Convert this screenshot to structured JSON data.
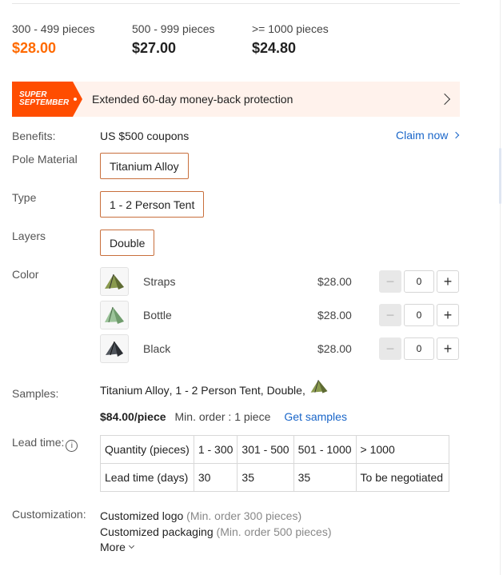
{
  "price_tiers": [
    {
      "range": "300 - 499 pieces",
      "price": "$28.00"
    },
    {
      "range": "500 - 999 pieces",
      "price": "$27.00"
    },
    {
      "range": ">= 1000 pieces",
      "price": "$24.80"
    }
  ],
  "promo": {
    "badge_line1": "SUPER",
    "badge_line2": "SEPTEMBER",
    "text": "Extended 60-day money-back protection"
  },
  "benefits": {
    "label": "Benefits:",
    "value": "US $500 coupons",
    "claim_label": "Claim now"
  },
  "pole_material": {
    "label": "Pole Material",
    "option": "Titanium Alloy"
  },
  "type": {
    "label": "Type",
    "option": "1 - 2 Person Tent"
  },
  "layers": {
    "label": "Layers",
    "option": "Double"
  },
  "color": {
    "label": "Color",
    "items": [
      {
        "name": "Straps",
        "price": "$28.00",
        "qty": "0",
        "tint": "#8a9a4e"
      },
      {
        "name": "Bottle",
        "price": "$28.00",
        "qty": "0",
        "tint": "#7fae7a"
      },
      {
        "name": "Black",
        "price": "$28.00",
        "qty": "0",
        "tint": "#3b3f45"
      }
    ]
  },
  "samples": {
    "label": "Samples:",
    "part1": "Titanium Alloy",
    "part2": "1 - 2 Person Tent",
    "part3": "Double",
    "price": "$84.00/piece",
    "min_order": "Min. order : 1 piece",
    "link": "Get samples"
  },
  "lead_time": {
    "label": "Lead time:",
    "info_icon": "i",
    "rows": [
      [
        "Quantity (pieces)",
        "1 - 300",
        "301 - 500",
        "501 - 1000",
        "> 1000"
      ],
      [
        "Lead time (days)",
        "30",
        "35",
        "35",
        "To be negotiated"
      ]
    ]
  },
  "customization": {
    "label": "Customization:",
    "items": [
      {
        "name": "Customized logo",
        "note": "(Min. order 300 pieces)"
      },
      {
        "name": "Customized packaging",
        "note": "(Min. order 500 pieces)"
      }
    ],
    "more_label": "More"
  },
  "colors": {
    "accent": "#ff6a00",
    "link": "#1a66c9",
    "option_border": "#c86f3c",
    "promo_bg": "#fff2ec"
  }
}
